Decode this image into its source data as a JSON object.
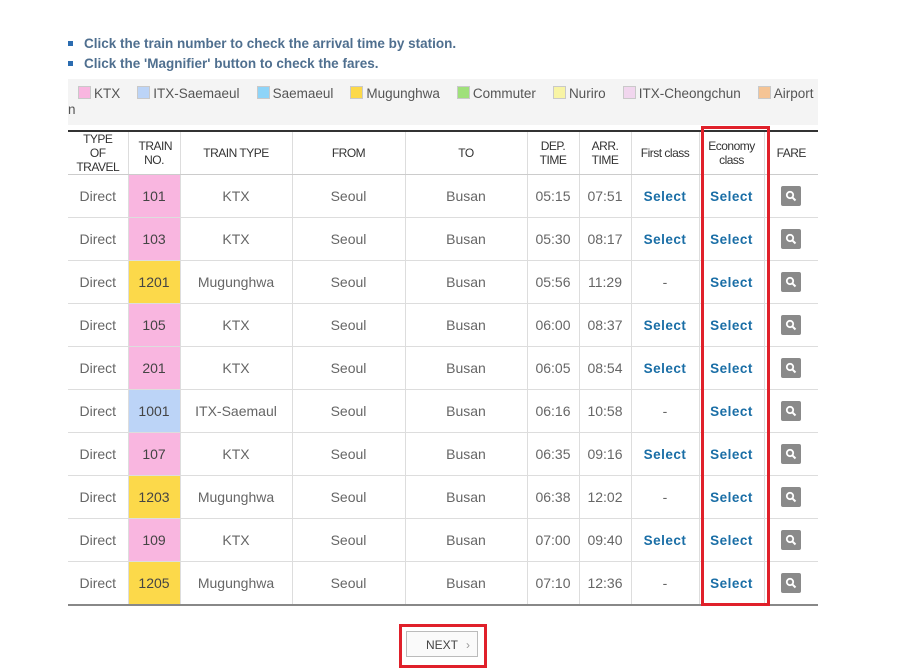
{
  "notes": [
    "Click the train number to check the arrival time by station.",
    "Click the 'Magnifier' button to check the fares."
  ],
  "legend": {
    "items": [
      {
        "label": "KTX",
        "color": "#f9b6e0"
      },
      {
        "label": "ITX-Saemaeul",
        "color": "#bcd4f7"
      },
      {
        "label": "Saemaeul",
        "color": "#8ed4f8"
      },
      {
        "label": "Mugunghwa",
        "color": "#fcd94a"
      },
      {
        "label": "Commuter",
        "color": "#9fe07a"
      },
      {
        "label": "Nuriro",
        "color": "#f8f4a5"
      },
      {
        "label": "ITX-Cheongchun",
        "color": "#f1d6ee"
      },
      {
        "label": "Airport Express Trai",
        "color": "#f5c495"
      }
    ],
    "wrap_text": "n"
  },
  "table": {
    "headers": {
      "type": "TYPE OF TRAVEL",
      "train_no": "TRAIN NO.",
      "train_type": "TRAIN TYPE",
      "from": "FROM",
      "to": "TO",
      "dep": "DEP. TIME",
      "arr": "ARR. TIME",
      "first": "First class",
      "economy": "Economy class",
      "fare": "FARE"
    },
    "rows": [
      {
        "type": "Direct",
        "no": "101",
        "train_type": "KTX",
        "from": "Seoul",
        "to": "Busan",
        "dep": "05:15",
        "arr": "07:51",
        "first": "Select",
        "economy": "Select"
      },
      {
        "type": "Direct",
        "no": "103",
        "train_type": "KTX",
        "from": "Seoul",
        "to": "Busan",
        "dep": "05:30",
        "arr": "08:17",
        "first": "Select",
        "economy": "Select"
      },
      {
        "type": "Direct",
        "no": "1201",
        "train_type": "Mugunghwa",
        "from": "Seoul",
        "to": "Busan",
        "dep": "05:56",
        "arr": "11:29",
        "first": "-",
        "economy": "Select"
      },
      {
        "type": "Direct",
        "no": "105",
        "train_type": "KTX",
        "from": "Seoul",
        "to": "Busan",
        "dep": "06:00",
        "arr": "08:37",
        "first": "Select",
        "economy": "Select"
      },
      {
        "type": "Direct",
        "no": "201",
        "train_type": "KTX",
        "from": "Seoul",
        "to": "Busan",
        "dep": "06:05",
        "arr": "08:54",
        "first": "Select",
        "economy": "Select"
      },
      {
        "type": "Direct",
        "no": "1001",
        "train_type": "ITX-Saemaul",
        "from": "Seoul",
        "to": "Busan",
        "dep": "06:16",
        "arr": "10:58",
        "first": "-",
        "economy": "Select"
      },
      {
        "type": "Direct",
        "no": "107",
        "train_type": "KTX",
        "from": "Seoul",
        "to": "Busan",
        "dep": "06:35",
        "arr": "09:16",
        "first": "Select",
        "economy": "Select"
      },
      {
        "type": "Direct",
        "no": "1203",
        "train_type": "Mugunghwa",
        "from": "Seoul",
        "to": "Busan",
        "dep": "06:38",
        "arr": "12:02",
        "first": "-",
        "economy": "Select"
      },
      {
        "type": "Direct",
        "no": "109",
        "train_type": "KTX",
        "from": "Seoul",
        "to": "Busan",
        "dep": "07:00",
        "arr": "09:40",
        "first": "Select",
        "economy": "Select"
      },
      {
        "type": "Direct",
        "no": "1205",
        "train_type": "Mugunghwa",
        "from": "Seoul",
        "to": "Busan",
        "dep": "07:10",
        "arr": "12:36",
        "first": "-",
        "economy": "Select"
      }
    ],
    "fare_icon": "magnifier-icon",
    "train_colors": {
      "KTX": "#f9b6e0",
      "Mugunghwa": "#fcd94a",
      "ITX-Saemaul": "#bcd4f7"
    }
  },
  "next_button": {
    "label": "NEXT",
    "chevron": "›"
  }
}
